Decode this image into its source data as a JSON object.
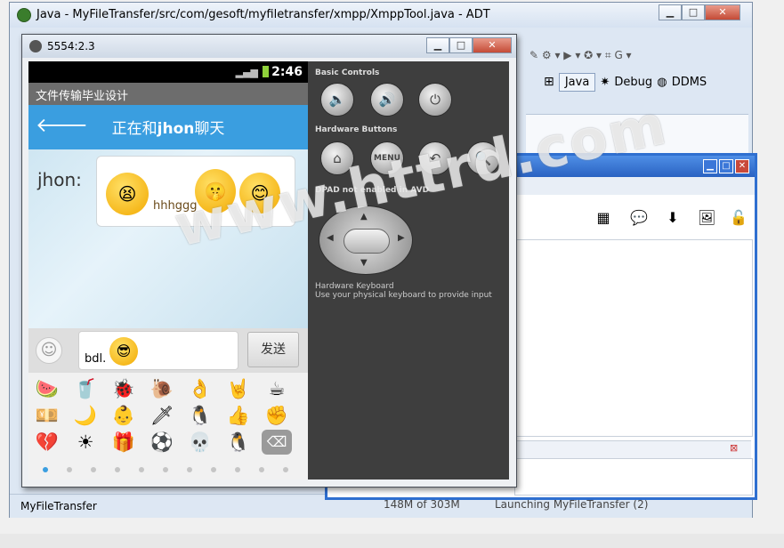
{
  "eclipse": {
    "title": "Java - MyFileTransfer/src/com/gesoft/myfiletransfer/xmpp/XmppTool.java - ADT",
    "perspective_java": "Java",
    "perspective_debug": "Debug",
    "perspective_ddms": "DDMS",
    "status_project": "MyFileTransfer",
    "status_memory": "148M of 303M",
    "status_launch": "Launching MyFileTransfer (2)"
  },
  "emulator": {
    "title": "5554:2.3",
    "clock": "2:46",
    "app_title": "文件传输毕业设计",
    "chat_header_prefix": "正在和",
    "chat_header_name": "jhon",
    "chat_header_suffix": "聊天",
    "sender": "jhon:",
    "message_text": "hhhggg",
    "input_text": "bdl.",
    "send_label": "发送"
  },
  "controls": {
    "basic_controls": "Basic Controls",
    "hardware_buttons": "Hardware Buttons",
    "menu_label": "MENU",
    "dpad_note": "DPAD not enabled in AVD",
    "keyboard_note": "Hardware Keyboard",
    "keyboard_note2": "Use your physical keyboard to provide input"
  },
  "watermark": "www.httrd.com",
  "emoji_rows": [
    [
      "🍉",
      "🥤",
      "🐞",
      "🐌",
      "👌",
      "🤘",
      "☕"
    ],
    [
      "💴",
      "🌙",
      "👶",
      "🗡",
      "🐧",
      "👍",
      "✊"
    ],
    [
      "💔",
      "☀",
      "🎁",
      "⚽",
      "💀",
      "🐧",
      "⌫"
    ]
  ]
}
